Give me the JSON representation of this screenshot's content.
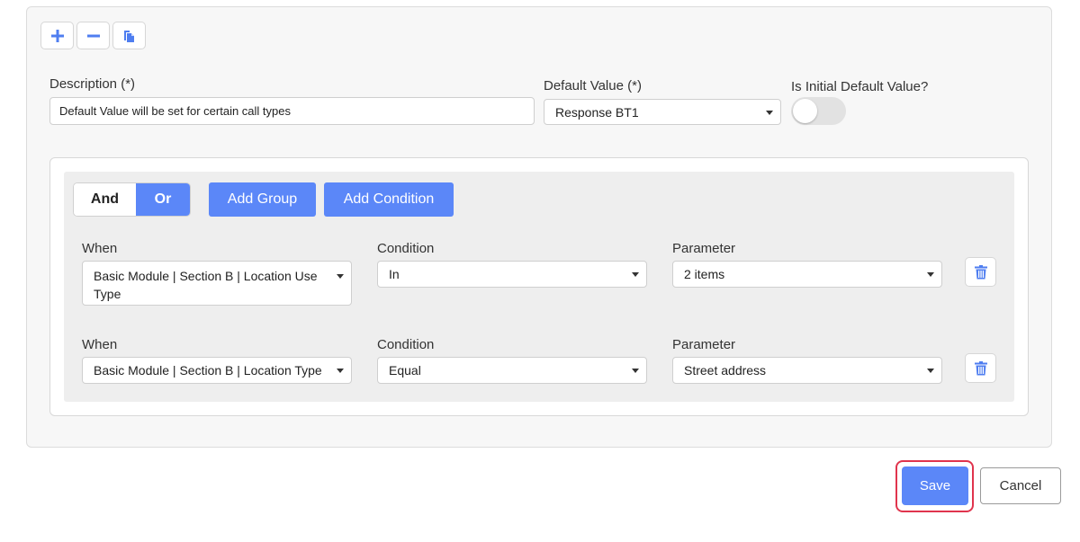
{
  "form": {
    "description_label": "Description (*)",
    "description_value": "Default Value will be set for certain call types",
    "default_value_label": "Default Value (*)",
    "default_value_selected": "Response BT1",
    "initial_default_label": "Is Initial Default Value?",
    "initial_default_on": false
  },
  "toolbar": {
    "icons": [
      "plus-icon",
      "minus-icon",
      "copy-icon"
    ]
  },
  "group": {
    "logic": {
      "and_label": "And",
      "or_label": "Or",
      "selected": "Or"
    },
    "add_group_label": "Add Group",
    "add_condition_label": "Add Condition",
    "rows": [
      {
        "when_label": "When",
        "when_value": "Basic Module | Section B | Location Use Type",
        "condition_label": "Condition",
        "condition_value": "In",
        "parameter_label": "Parameter",
        "parameter_value": "2 items"
      },
      {
        "when_label": "When",
        "when_value": "Basic Module | Section B | Location Type",
        "condition_label": "Condition",
        "condition_value": "Equal",
        "parameter_label": "Parameter",
        "parameter_value": "Street address"
      }
    ]
  },
  "footer": {
    "save_label": "Save",
    "cancel_label": "Cancel"
  },
  "colors": {
    "accent": "#5b87f8",
    "highlight": "#e0344d",
    "panel_bg": "#f7f7f7",
    "group_bg": "#eeeeee"
  }
}
